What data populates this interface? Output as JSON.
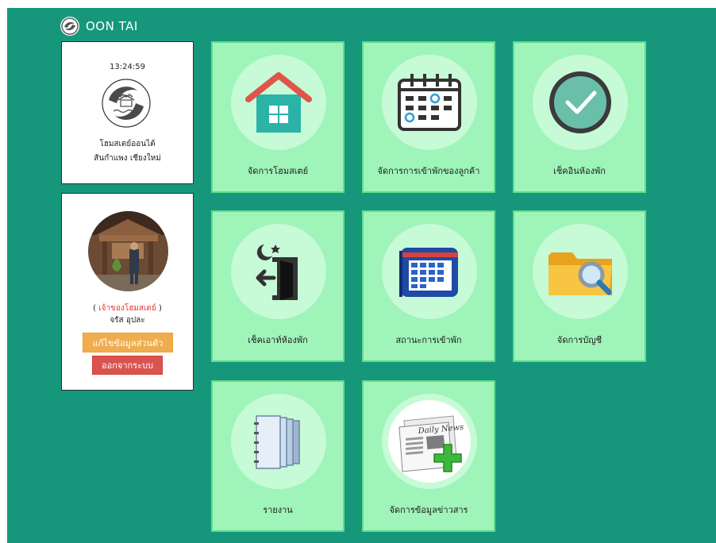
{
  "brand": {
    "name": "OON TAI"
  },
  "sidebar": {
    "clock": "13:24:59",
    "place_line1": "โฮมสเตย์ออนไต้",
    "place_line2": "สันกำแพง เชียงใหม่",
    "profile": {
      "role": "เจ้าของโฮมสเตย์",
      "paren_open": "(",
      "paren_close": ")",
      "name": "จรัส อุปละ",
      "edit_label": "แก้ไขข้อมูลส่วนตัว",
      "logout_label": "ออกจากระบบ"
    }
  },
  "menu": {
    "tiles": [
      {
        "label": "จัดการโฮมสเตย์",
        "icon": "house-icon"
      },
      {
        "label": "จัดการการเข้าพักของลูกค้า",
        "icon": "calendar-icon"
      },
      {
        "label": "เช็คอินห้องพัก",
        "icon": "checkmark-icon"
      },
      {
        "label": "เช็คเอาท์ห้องพัก",
        "icon": "exit-door-icon"
      },
      {
        "label": "สถานะการเข้าพัก",
        "icon": "schedule-book-icon"
      },
      {
        "label": "จัดการบัญชี",
        "icon": "folder-search-icon"
      },
      {
        "label": "รายงาน",
        "icon": "notebooks-icon"
      },
      {
        "label": "จัดการข้อมูลข่าวสาร",
        "icon": "newspaper-add-icon"
      }
    ],
    "newspaper_masthead": "Daily News"
  },
  "colors": {
    "background": "#16977c",
    "tile": "#9ff4b9",
    "tile_border": "#5fdd8c",
    "icon_circle": "#c7fad6",
    "edit_button": "#f0ad4e",
    "logout_button": "#d9534f",
    "role_text": "#e53935"
  }
}
